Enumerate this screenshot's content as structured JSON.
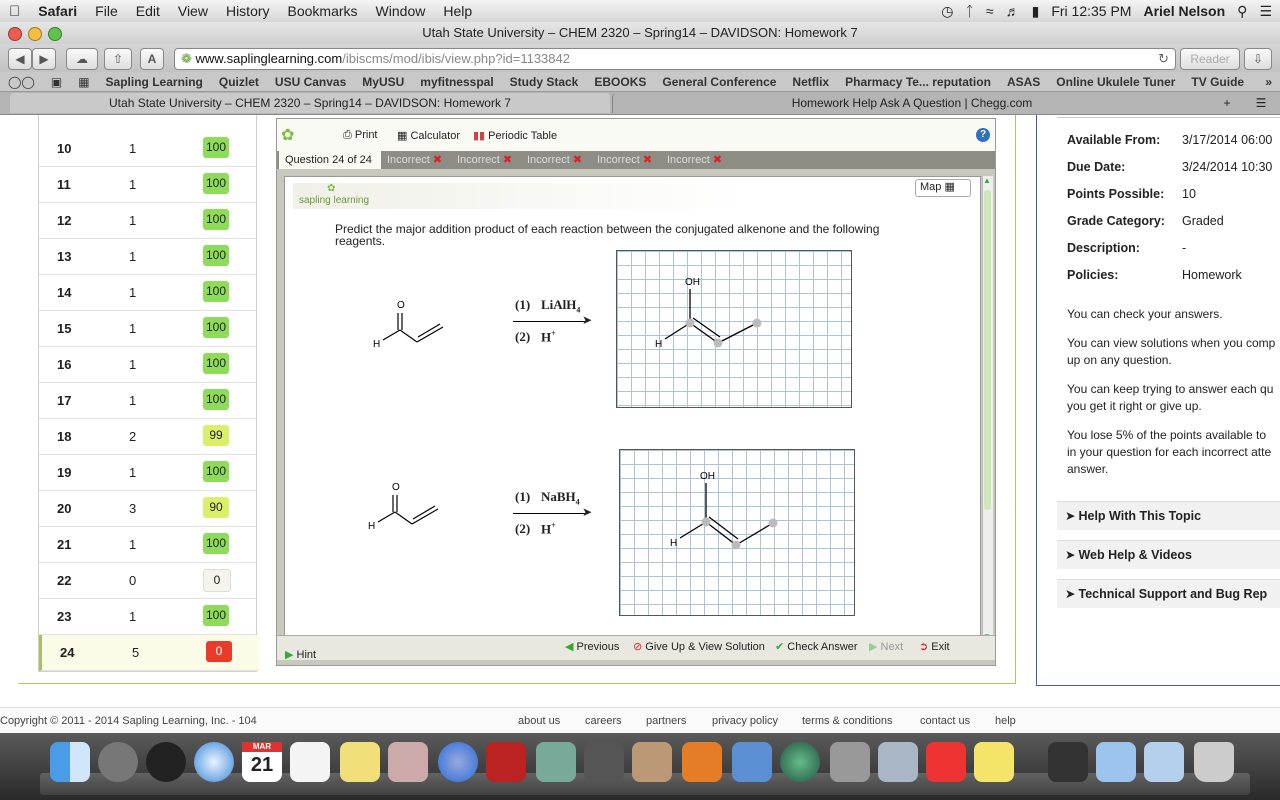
{
  "menubar": {
    "app": "Safari",
    "items": [
      "File",
      "Edit",
      "View",
      "History",
      "Bookmarks",
      "Window",
      "Help"
    ],
    "clock": "Fri 12:35 PM",
    "user": "Ariel Nelson"
  },
  "window": {
    "title": "Utah State University – CHEM 2320 – Spring14 – DAVIDSON: Homework 7",
    "url_host": "www.saplinglearning.com",
    "url_path": "/ibiscms/mod/ibis/view.php?id=1133842",
    "reader_label": "Reader"
  },
  "bookmarks": [
    "Sapling Learning",
    "Quizlet",
    "USU Canvas",
    "MyUSU",
    "myfitnesspal",
    "Study Stack",
    "EBOOKS",
    "General Conference",
    "Netflix",
    "Pharmacy Te... reputation",
    "ASAS",
    "Online Ukulele Tuner",
    "TV Guide"
  ],
  "tabs": [
    {
      "label": "Utah State University – CHEM 2320 – Spring14 – DAVIDSON: Homework 7"
    },
    {
      "label": "Homework Help Ask A Question | Chegg.com"
    }
  ],
  "questions": [
    {
      "q": "10",
      "attempts": "1",
      "score": "100"
    },
    {
      "q": "11",
      "attempts": "1",
      "score": "100"
    },
    {
      "q": "12",
      "attempts": "1",
      "score": "100"
    },
    {
      "q": "13",
      "attempts": "1",
      "score": "100"
    },
    {
      "q": "14",
      "attempts": "1",
      "score": "100"
    },
    {
      "q": "15",
      "attempts": "1",
      "score": "100"
    },
    {
      "q": "16",
      "attempts": "1",
      "score": "100"
    },
    {
      "q": "17",
      "attempts": "1",
      "score": "100"
    },
    {
      "q": "18",
      "attempts": "2",
      "score": "99"
    },
    {
      "q": "19",
      "attempts": "1",
      "score": "100"
    },
    {
      "q": "20",
      "attempts": "3",
      "score": "90"
    },
    {
      "q": "21",
      "attempts": "1",
      "score": "100"
    },
    {
      "q": "22",
      "attempts": "0",
      "score": "0"
    },
    {
      "q": "23",
      "attempts": "1",
      "score": "100"
    },
    {
      "q": "24",
      "attempts": "5",
      "score": "0"
    }
  ],
  "tools": {
    "print": "Print",
    "calculator": "Calculator",
    "periodic": "Periodic Table"
  },
  "question_tabs": {
    "current": "Question 24 of 24",
    "attempts": [
      "Incorrect",
      "Incorrect",
      "Incorrect",
      "Incorrect",
      "Incorrect"
    ]
  },
  "question": {
    "logo": "sapling learning",
    "map": "Map",
    "prompt_line1": "Predict the major addition product of each reaction between the conjugated alkenone and the following",
    "prompt_line2": "reagents.",
    "r1_step1": "(1)",
    "r1_reagent1": "LiAlH",
    "r1_sub": "4",
    "r1_step2": "(2)",
    "r1_reagent2": "H",
    "r2_step1": "(1)",
    "r2_reagent1": "NaBH",
    "r2_sub": "4",
    "r2_step2": "(2)",
    "r2_reagent2": "H",
    "plus": "+",
    "atom_o": "O",
    "atom_h": "H",
    "atom_oh": "OH"
  },
  "nav": {
    "hint": "Hint",
    "previous": "Previous",
    "giveup": "Give Up & View Solution",
    "check": "Check Answer",
    "next": "Next",
    "exit": "Exit"
  },
  "info": {
    "available_label": "Available From:",
    "available": "3/17/2014 06:00",
    "due_label": "Due Date:",
    "due": "3/24/2014 10:30",
    "points_label": "Points Possible:",
    "points": "10",
    "grade_label": "Grade Category:",
    "grade": "Graded",
    "desc_label": "Description:",
    "desc": "-",
    "policies_label": "Policies:",
    "policies": "Homework",
    "p1": "You can check your answers.",
    "p2a": "You can view solutions when you comp",
    "p2b": "up on any question.",
    "p3a": "You can keep trying to answer each qu",
    "p3b": "you get it right or give up.",
    "p4a": "You lose 5% of the points available to",
    "p4b": "in your question for each incorrect atte",
    "p4c": "answer."
  },
  "accordion": [
    "Help With This Topic",
    "Web Help & Videos",
    "Technical Support and Bug Rep"
  ],
  "footer": {
    "copyright": "Copyright © 2011 - 2014 Sapling Learning, Inc. - 104",
    "links": [
      "about us",
      "careers",
      "partners",
      "privacy policy",
      "terms & conditions",
      "contact us",
      "help"
    ]
  },
  "dock": {
    "calendar_day": "21",
    "calendar_month": "MAR"
  },
  "colors": {
    "score_green": "#8fdc5a",
    "score_yellow": "#dcef6a",
    "score_red": "#e83b2a",
    "score_zero": "#f4f4ec"
  }
}
